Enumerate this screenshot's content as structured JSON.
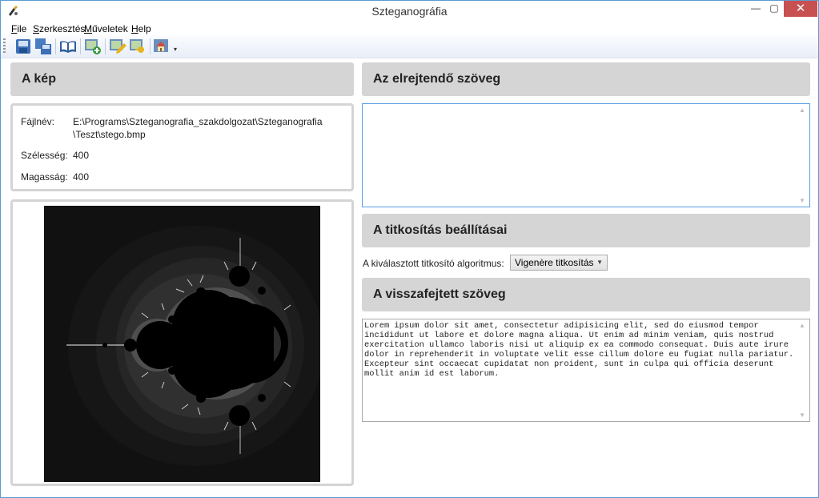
{
  "window": {
    "title": "Szteganográfia",
    "controls": {
      "minimize": "—",
      "maximize": "▢",
      "close": "✕"
    }
  },
  "menu": [
    {
      "label": "File"
    },
    {
      "label": "Szerkesztés"
    },
    {
      "label": "Műveletek"
    },
    {
      "label": "Help"
    }
  ],
  "toolbar": {
    "icons": [
      "save-icon",
      "save-all-icon",
      "book-icon",
      "add-image-icon",
      "edit-icon",
      "edit-key-icon",
      "home-icon"
    ],
    "overflow": "▾"
  },
  "image_panel": {
    "heading": "A kép",
    "info": {
      "filename_label": "Fájlnév:",
      "filename_line1": "E:\\Programs\\Szteganografia_szakdolgozat\\Szteganografia",
      "filename_line2": "\\Teszt\\stego.bmp",
      "width_label": "Szélesség:",
      "width_value": "400",
      "height_label": "Magasság:",
      "height_value": "400"
    }
  },
  "hidden_text_panel": {
    "heading": "Az elrejtendő szöveg",
    "text": ""
  },
  "encryption_panel": {
    "heading": "A titkosítás beállításai",
    "algorithm_label": "A kiválasztott titkosító algoritmus:",
    "algorithm_value": "Vigenère titkosítás"
  },
  "decoded_panel": {
    "heading": "A visszafejtett szöveg",
    "text": "Lorem ipsum dolor sit amet, consectetur adipisicing elit, sed do eiusmod tempor\nincididunt ut labore et dolore magna aliqua. Ut enim ad minim veniam, quis nostrud\nexercitation ullamco laboris nisi ut aliquip ex ea commodo consequat. Duis aute irure\ndolor in reprehenderit in voluptate velit esse cillum dolore eu fugiat nulla pariatur.\nExcepteur sint occaecat cupidatat non proident, sunt in culpa qui officia deserunt\nmollit anim id est laborum."
  },
  "colors": {
    "accent": "#569de5",
    "panel_header": "#d5d5d5",
    "close_button": "#c75050"
  }
}
